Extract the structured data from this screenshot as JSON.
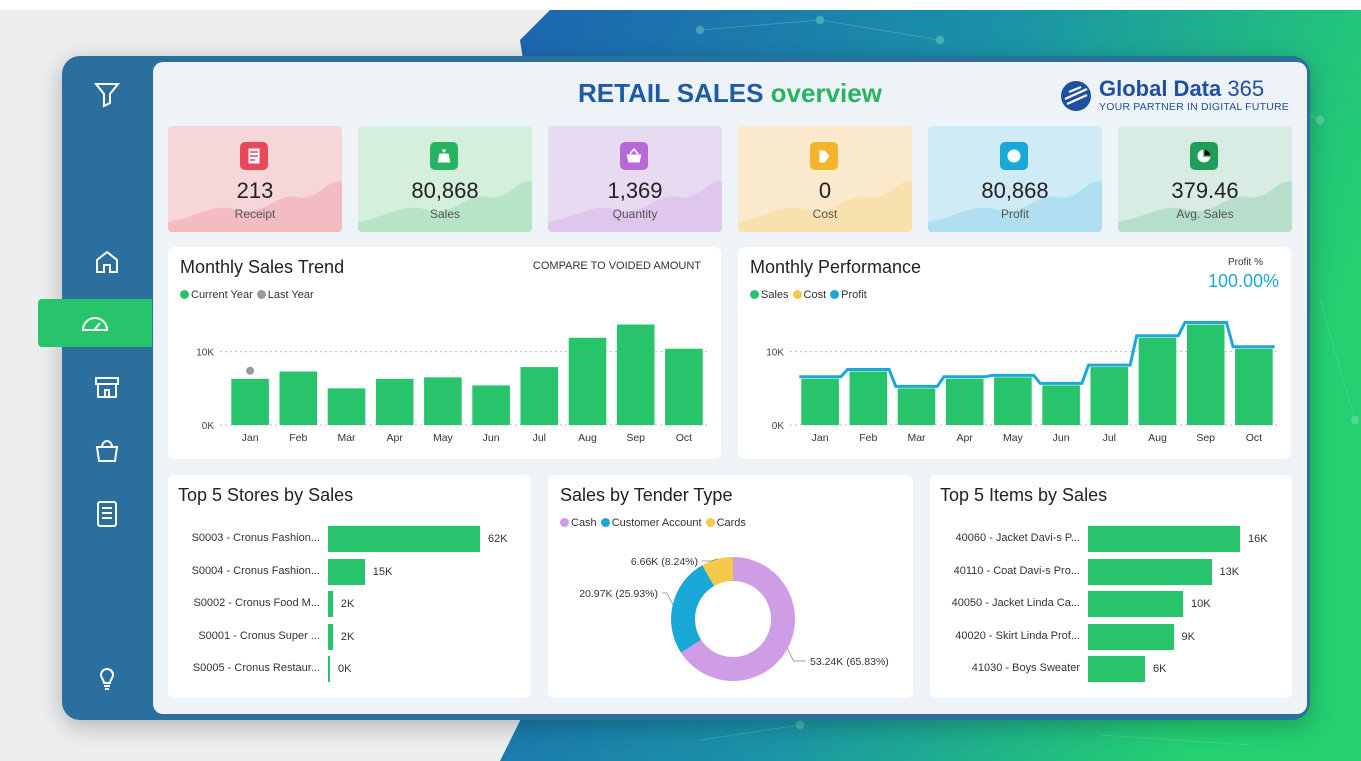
{
  "header": {
    "title_a": "RETAIL SALES",
    "title_b": "overview"
  },
  "brand": {
    "name_a": "Global Data",
    "name_b": "365",
    "tagline": "YOUR PARTNER IN DIGITAL FUTURE"
  },
  "sidebar": {
    "items": [
      "filter-icon",
      "home-icon",
      "dashboard-icon",
      "store-icon",
      "bag-icon",
      "report-icon",
      "bulb-icon"
    ],
    "active": "dashboard-icon"
  },
  "kpis": [
    {
      "value": "213",
      "label": "Receipt",
      "color": "#f6d6d9",
      "icon_color": "#e8495a",
      "icon": "receipt-icon"
    },
    {
      "value": "80,868",
      "label": "Sales",
      "color": "#d5efdd",
      "icon_color": "#27b35f",
      "icon": "money-bag-icon"
    },
    {
      "value": "1,369",
      "label": "Quantity",
      "color": "#e8dbf1",
      "icon_color": "#b56ad6",
      "icon": "basket-icon"
    },
    {
      "value": "0",
      "label": "Cost",
      "color": "#fbe9cc",
      "icon_color": "#f2b52b",
      "icon": "tag-icon"
    },
    {
      "value": "80,868",
      "label": "Profit",
      "color": "#cfebf5",
      "icon_color": "#1aa8d8",
      "icon": "coin-icon"
    },
    {
      "value": "379.46",
      "label": "Avg. Sales",
      "color": "#d8ece3",
      "icon_color": "#1f9e5a",
      "icon": "pie-icon"
    }
  ],
  "monthly_trend": {
    "title": "Monthly Sales Trend",
    "compare_label": "COMPARE TO VOIDED AMOUNT",
    "legend": [
      "Current Year",
      "Last Year"
    ],
    "legend_colors": [
      "#27c46b",
      "#9a9a9a"
    ]
  },
  "monthly_perf": {
    "title": "Monthly Performance",
    "legend": [
      "Sales",
      "Cost",
      "Profit"
    ],
    "legend_colors": [
      "#27c46b",
      "#f7c948",
      "#1aa8d8"
    ],
    "profit_label": "Profit %",
    "profit_value": "100.00%"
  },
  "top_stores": {
    "title": "Top 5 Stores by Sales"
  },
  "tender": {
    "title": "Sales by Tender Type",
    "legend": [
      "Cash",
      "Customer Account",
      "Cards"
    ],
    "legend_colors": [
      "#cf9ce6",
      "#1aa8d8",
      "#f7c948"
    ]
  },
  "top_items": {
    "title": "Top 5 Items by Sales"
  },
  "chart_data": [
    {
      "type": "bar",
      "title": "Monthly Sales Trend",
      "categories": [
        "Jan",
        "Feb",
        "Mar",
        "Apr",
        "May",
        "Jun",
        "Jul",
        "Aug",
        "Sep",
        "Oct"
      ],
      "series": [
        {
          "name": "Current Year",
          "values": [
            6300,
            7300,
            5000,
            6300,
            6500,
            5400,
            7900,
            11900,
            13700,
            10400
          ]
        },
        {
          "name": "Last Year",
          "values": [
            7400,
            null,
            null,
            null,
            null,
            null,
            null,
            null,
            null,
            null
          ]
        }
      ],
      "ylim": [
        0,
        15000
      ],
      "yticks": [
        "0K",
        "10K"
      ]
    },
    {
      "type": "bar",
      "title": "Monthly Performance",
      "categories": [
        "Jan",
        "Feb",
        "Mar",
        "Apr",
        "May",
        "Jun",
        "Jul",
        "Aug",
        "Sep",
        "Oct"
      ],
      "series": [
        {
          "name": "Sales",
          "values": [
            6300,
            7300,
            5000,
            6300,
            6500,
            5400,
            7900,
            11900,
            13700,
            10400
          ]
        },
        {
          "name": "Cost",
          "values": [
            0,
            0,
            0,
            0,
            0,
            0,
            0,
            0,
            0,
            0
          ]
        },
        {
          "name": "Profit",
          "values": [
            6300,
            7300,
            5000,
            6300,
            6500,
            5400,
            7900,
            11900,
            13700,
            10400
          ]
        }
      ],
      "ylim": [
        0,
        15000
      ],
      "yticks": [
        "0K",
        "10K"
      ]
    },
    {
      "type": "bar",
      "title": "Top 5 Stores by Sales",
      "orientation": "horizontal",
      "categories": [
        "S0003 - Cronus Fashion...",
        "S0004 - Cronus Fashion...",
        "S0002 - Cronus Food M...",
        "S0001 - Cronus Super ...",
        "S0005 - Cronus Restaur..."
      ],
      "values": [
        62,
        15,
        2,
        2,
        0.3
      ],
      "labels": [
        "62K",
        "15K",
        "2K",
        "2K",
        "0K"
      ]
    },
    {
      "type": "pie",
      "title": "Sales by Tender Type",
      "categories": [
        "Cash",
        "Customer Account",
        "Cards"
      ],
      "values": [
        53.24,
        20.97,
        6.66
      ],
      "labels": [
        "53.24K (65.83%)",
        "20.97K (25.93%)",
        "6.66K (8.24%)"
      ]
    },
    {
      "type": "bar",
      "title": "Top 5 Items by Sales",
      "orientation": "horizontal",
      "categories": [
        "40060 - Jacket Davi-s P...",
        "40110 - Coat Davi-s Pro...",
        "40050 - Jacket Linda Ca...",
        "40020 - Skirt Linda Prof...",
        "41030 - Boys Sweater"
      ],
      "values": [
        16,
        13,
        10,
        9,
        6
      ],
      "labels": [
        "16K",
        "13K",
        "10K",
        "9K",
        "6K"
      ]
    }
  ]
}
